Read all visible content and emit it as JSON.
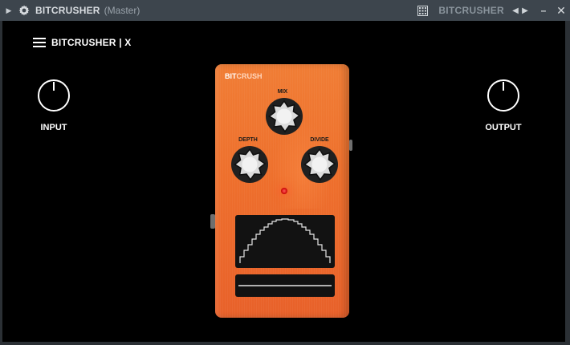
{
  "titlebar": {
    "plugin_name": "BITCRUSHER",
    "routing": "(Master)",
    "preset_name": "BITCRUSHER",
    "prev_symbol": "◀",
    "next_symbol": "▶",
    "minimize_symbol": "–",
    "close_symbol": "✕",
    "icons": [
      "collapse-arrow-icon",
      "gear-icon",
      "grid-icon",
      "chevron-left-icon",
      "chevron-right-icon"
    ]
  },
  "header": {
    "title": "BITCRUSHER | X"
  },
  "controls": {
    "input_label": "INPUT",
    "output_label": "OUTPUT"
  },
  "pedal": {
    "brand_part1": "BIT",
    "brand_part2": "CRUSH",
    "knobs": {
      "mix_label": "MIX",
      "depth_label": "DEPTH",
      "divide_label": "DIVIDE"
    },
    "color": "#ee6f2c",
    "led_color": "#e01010"
  }
}
